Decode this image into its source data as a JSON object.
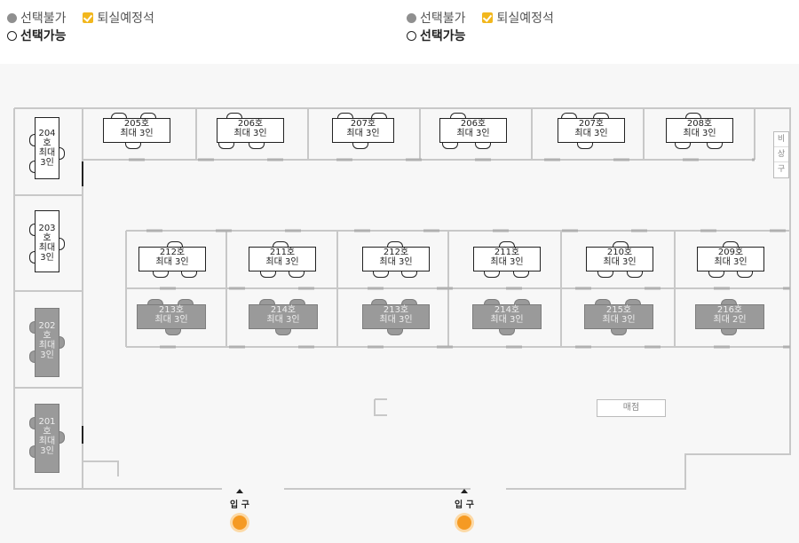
{
  "legend": {
    "unavailable": "선택불가",
    "checkout_planned": "퇴실예정석",
    "available": "선택가능"
  },
  "side_rooms": [
    {
      "number": "204",
      "suffix": "호",
      "cap1": "최대",
      "cap2": "3인",
      "status": "available"
    },
    {
      "number": "203",
      "suffix": "호",
      "cap1": "최대",
      "cap2": "3인",
      "status": "available"
    },
    {
      "number": "202",
      "suffix": "호",
      "cap1": "최대",
      "cap2": "3인",
      "status": "unavailable"
    },
    {
      "number": "201",
      "suffix": "호",
      "cap1": "최대",
      "cap2": "3인",
      "status": "unavailable"
    }
  ],
  "top_rooms": [
    {
      "name": "205호",
      "cap": "최대 3인",
      "status": "available"
    },
    {
      "name": "206호",
      "cap": "최대 3인",
      "status": "available"
    },
    {
      "name": "207호",
      "cap": "최대 3인",
      "status": "available"
    },
    {
      "name": "206호",
      "cap": "최대 3인",
      "status": "available"
    },
    {
      "name": "207호",
      "cap": "최대 3인",
      "status": "available"
    },
    {
      "name": "208호",
      "cap": "최대 3인",
      "status": "available"
    }
  ],
  "mid_rooms": [
    {
      "name": "212호",
      "cap": "최대 3인",
      "status": "available"
    },
    {
      "name": "211호",
      "cap": "최대 3인",
      "status": "available"
    },
    {
      "name": "212호",
      "cap": "최대 3인",
      "status": "available"
    },
    {
      "name": "211호",
      "cap": "최대 3인",
      "status": "available"
    },
    {
      "name": "210호",
      "cap": "최대 3인",
      "status": "available"
    },
    {
      "name": "209호",
      "cap": "최대 3인",
      "status": "available"
    }
  ],
  "low_rooms": [
    {
      "name": "213호",
      "cap": "최대 3인",
      "status": "unavailable"
    },
    {
      "name": "214호",
      "cap": "최대 3인",
      "status": "unavailable"
    },
    {
      "name": "213호",
      "cap": "최대 3인",
      "status": "unavailable"
    },
    {
      "name": "214호",
      "cap": "최대 3인",
      "status": "unavailable"
    },
    {
      "name": "215호",
      "cap": "최대 3인",
      "status": "unavailable"
    },
    {
      "name": "216호",
      "cap": "최대 2인",
      "status": "unavailable"
    }
  ],
  "emergency_stairs": [
    "비",
    "상",
    "구"
  ],
  "store": "매점",
  "entrances": [
    "입 구",
    "입 구"
  ],
  "colors": {
    "checkout_accent": "#f2b71d",
    "entrance_marker": "#f59a23",
    "unavailable_fill": "#9a9a9a"
  }
}
